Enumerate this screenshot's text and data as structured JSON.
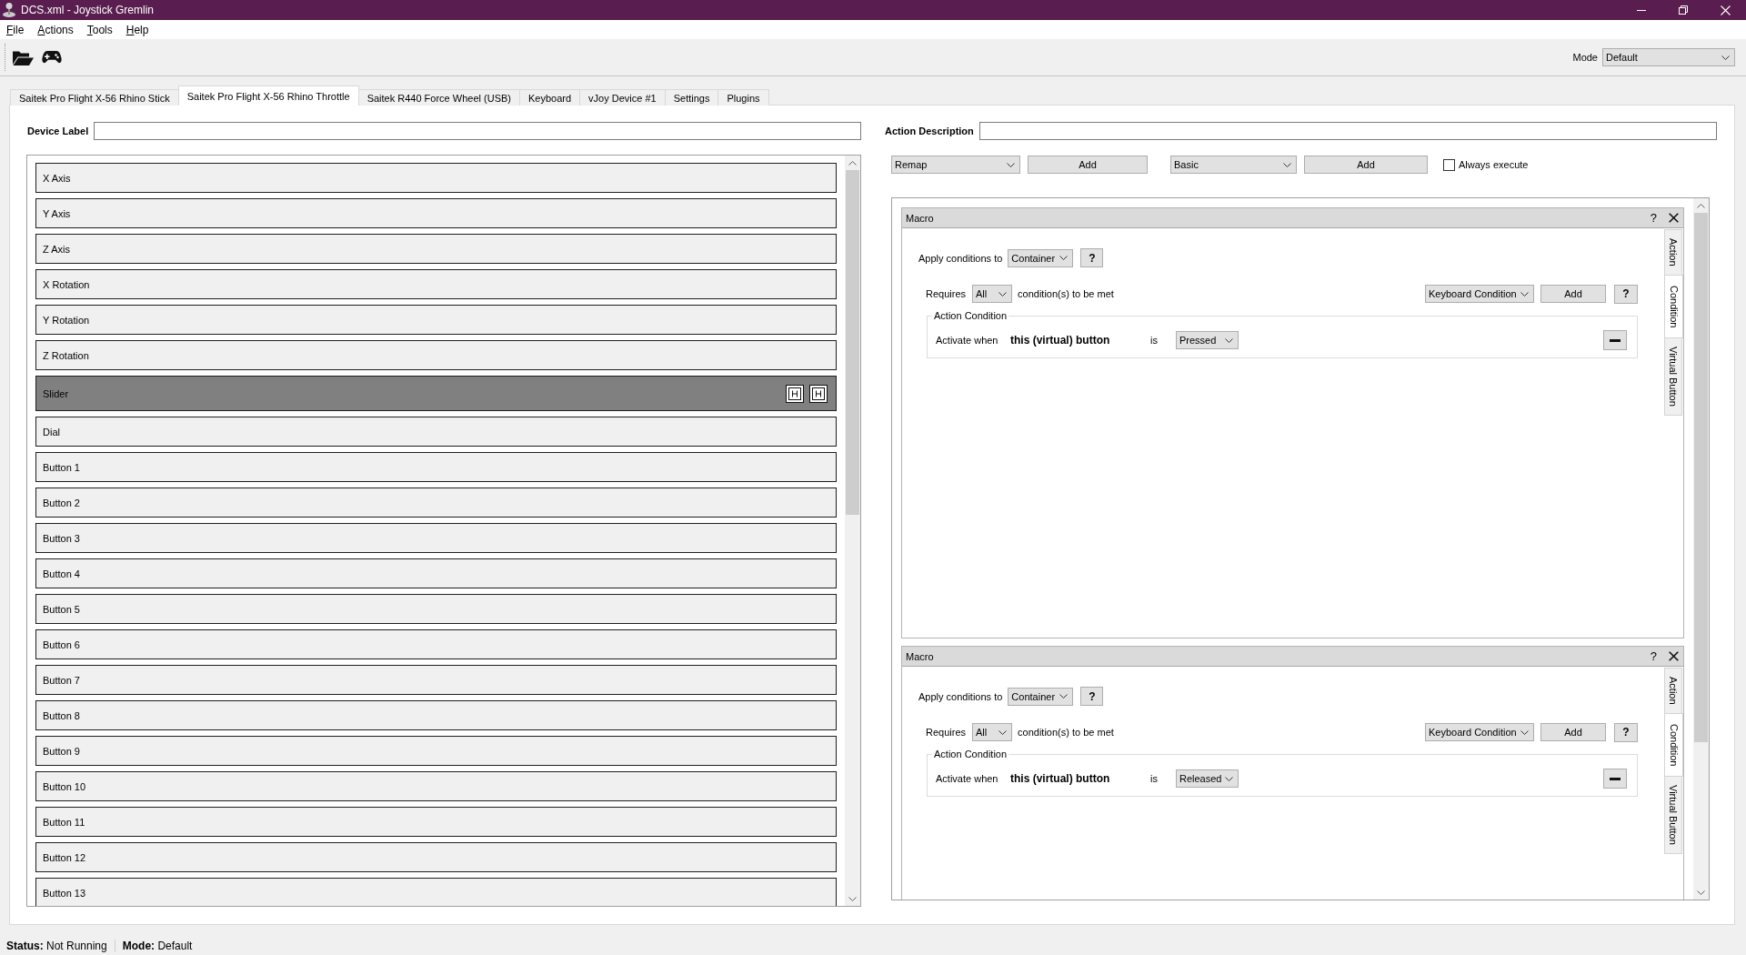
{
  "window": {
    "title": "DCS.xml - Joystick Gremlin"
  },
  "menu": [
    "File",
    "Actions",
    "Tools",
    "Help"
  ],
  "toolbar": {
    "mode_label": "Mode",
    "mode": "Default"
  },
  "tabs": [
    {
      "label": "Saitek Pro Flight X-56 Rhino Stick",
      "selected": false
    },
    {
      "label": "Saitek Pro Flight X-56 Rhino Throttle",
      "selected": true
    },
    {
      "label": "Saitek R440 Force Wheel (USB)",
      "selected": false
    },
    {
      "label": "Keyboard",
      "selected": false
    },
    {
      "label": "vJoy Device #1",
      "selected": false
    },
    {
      "label": "Settings",
      "selected": false
    },
    {
      "label": "Plugins",
      "selected": false
    }
  ],
  "device": {
    "label": "Device Label"
  },
  "inputs": [
    {
      "label": "X Axis",
      "selected": false
    },
    {
      "label": "Y Axis",
      "selected": false
    },
    {
      "label": "Z Axis",
      "selected": false
    },
    {
      "label": "X Rotation",
      "selected": false
    },
    {
      "label": "Y Rotation",
      "selected": false
    },
    {
      "label": "Z Rotation",
      "selected": false
    },
    {
      "label": "Slider",
      "selected": true
    },
    {
      "label": "Dial",
      "selected": false
    },
    {
      "label": "Button 1",
      "selected": false
    },
    {
      "label": "Button 2",
      "selected": false
    },
    {
      "label": "Button 3",
      "selected": false
    },
    {
      "label": "Button 4",
      "selected": false
    },
    {
      "label": "Button 5",
      "selected": false
    },
    {
      "label": "Button 6",
      "selected": false
    },
    {
      "label": "Button 7",
      "selected": false
    },
    {
      "label": "Button 8",
      "selected": false
    },
    {
      "label": "Button 9",
      "selected": false
    },
    {
      "label": "Button 10",
      "selected": false
    },
    {
      "label": "Button 11",
      "selected": false
    },
    {
      "label": "Button 12",
      "selected": false
    },
    {
      "label": "Button 13",
      "selected": false
    }
  ],
  "action": {
    "description_label": "Action Description",
    "container_type": "Remap",
    "add_container": "Add",
    "action_type": "Basic",
    "add_action": "Add",
    "always_execute": {
      "label": "Always execute",
      "checked": false
    }
  },
  "macros": [
    {
      "title": "Macro",
      "help": "?",
      "side_tabs": [
        {
          "label": "Action",
          "selected": false
        },
        {
          "label": "Condition",
          "selected": true
        },
        {
          "label": "Virtual Button",
          "selected": false
        }
      ],
      "apply_label": "Apply conditions to",
      "apply_to": "Container",
      "apply_help": "?",
      "requires_label": "Requires",
      "requires": "All",
      "requires_suffix": "condition(s) to be met",
      "condition_type": "Keyboard Condition",
      "add": "Add",
      "condition_help": "?",
      "group_title": "Action Condition",
      "activate_label": "Activate when",
      "subject": "this (virtual) button",
      "is_label": "is",
      "state": "Pressed"
    },
    {
      "title": "Macro",
      "help": "?",
      "side_tabs": [
        {
          "label": "Action",
          "selected": false
        },
        {
          "label": "Condition",
          "selected": true
        },
        {
          "label": "Virtual Button",
          "selected": false
        }
      ],
      "apply_label": "Apply conditions to",
      "apply_to": "Container",
      "apply_help": "?",
      "requires_label": "Requires",
      "requires": "All",
      "requires_suffix": "condition(s) to be met",
      "condition_type": "Keyboard Condition",
      "add": "Add",
      "condition_help": "?",
      "group_title": "Action Condition",
      "activate_label": "Activate when",
      "subject": "this (virtual) button",
      "is_label": "is",
      "state": "Released"
    }
  ],
  "status_bar": [
    "**Status:** Not Running",
    "**Mode:** Default"
  ]
}
